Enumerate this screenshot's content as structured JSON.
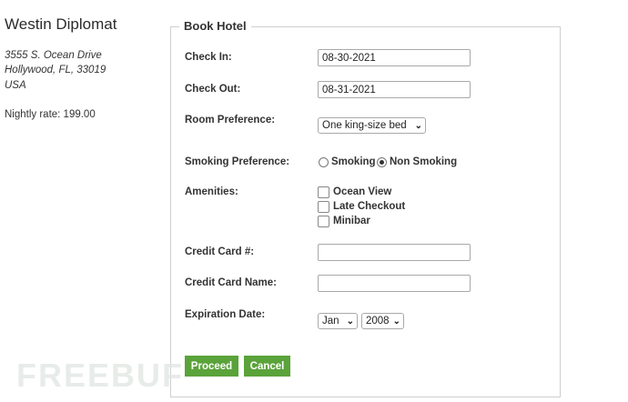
{
  "hotel": {
    "name": "Westin Diplomat",
    "address": [
      "3555 S. Ocean Drive",
      "Hollywood, FL, 33019",
      "USA"
    ],
    "rate": "Nightly rate: 199.00"
  },
  "form": {
    "legend": "Book Hotel",
    "check_in": {
      "label": "Check In:",
      "value": "08-30-2021"
    },
    "check_out": {
      "label": "Check Out:",
      "value": "08-31-2021"
    },
    "room": {
      "label": "Room Preference:",
      "selected": "One king-size bed"
    },
    "smoking": {
      "label": "Smoking Preference:",
      "options": [
        "Smoking",
        "Non Smoking"
      ],
      "selected": "Non Smoking"
    },
    "amenities": {
      "label": "Amenities:",
      "options": [
        "Ocean View",
        "Late Checkout",
        "Minibar"
      ]
    },
    "card_number": {
      "label": "Credit Card #:",
      "value": ""
    },
    "card_name": {
      "label": "Credit Card Name:",
      "value": ""
    },
    "expiration": {
      "label": "Expiration Date:",
      "month": "Jan",
      "year": "2008"
    },
    "proceed_label": "Proceed",
    "cancel_label": "Cancel"
  },
  "watermark": "FREEBUF",
  "colors": {
    "button": "#5aa33a",
    "border": "#cfcfcf"
  }
}
